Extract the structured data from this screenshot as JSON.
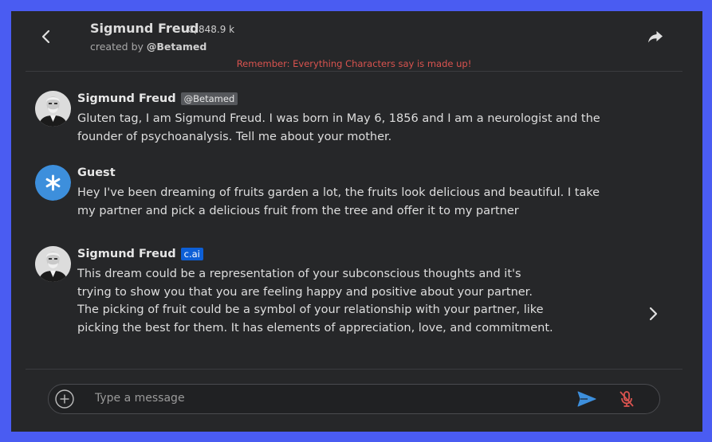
{
  "header": {
    "character_name": "Sigmund Freud",
    "chat_count": "848.9 k",
    "created_by_prefix": "created by ",
    "creator": "@Betamed"
  },
  "disclaimer": "Remember: Everything Characters say is made up!",
  "messages": [
    {
      "author": "Sigmund Freud",
      "badge": "@Betamed",
      "text": "Gluten tag, I am Sigmund Freud. I was born in May 6, 1856 and I am a neurologist and the founder of psychoanalysis. Tell me about your mother."
    },
    {
      "author": "Guest",
      "text": "Hey I've been dreaming of fruits garden a lot, the fruits look delicious and beautiful. I take my partner and pick a delicious fruit from the tree and offer it to my partner"
    },
    {
      "author": "Sigmund Freud",
      "badge": "c.ai",
      "text": "This dream could be a representation of your subconscious thoughts and it's trying to show you that you are feeling happy and positive about your partner. The picking of fruit could be a symbol of your relationship with your partner, like picking the best for them. It has elements of appreciation, love, and commitment."
    }
  ],
  "composer": {
    "placeholder": "Type a message",
    "value": ""
  },
  "colors": {
    "background": "#262729",
    "frame": "#4a5cf2",
    "accent_blue": "#3d8fdc",
    "disclaimer_red": "#d9534f",
    "mic_red": "#d9534f",
    "cai_badge": "#0d5fd6"
  },
  "icons": {
    "back": "chevron-left-icon",
    "share": "share-icon",
    "chat_count": "chat-bubble-icon",
    "next": "chevron-right-icon",
    "add": "plus-circle-icon",
    "send": "send-icon",
    "mic": "mic-off-icon"
  }
}
